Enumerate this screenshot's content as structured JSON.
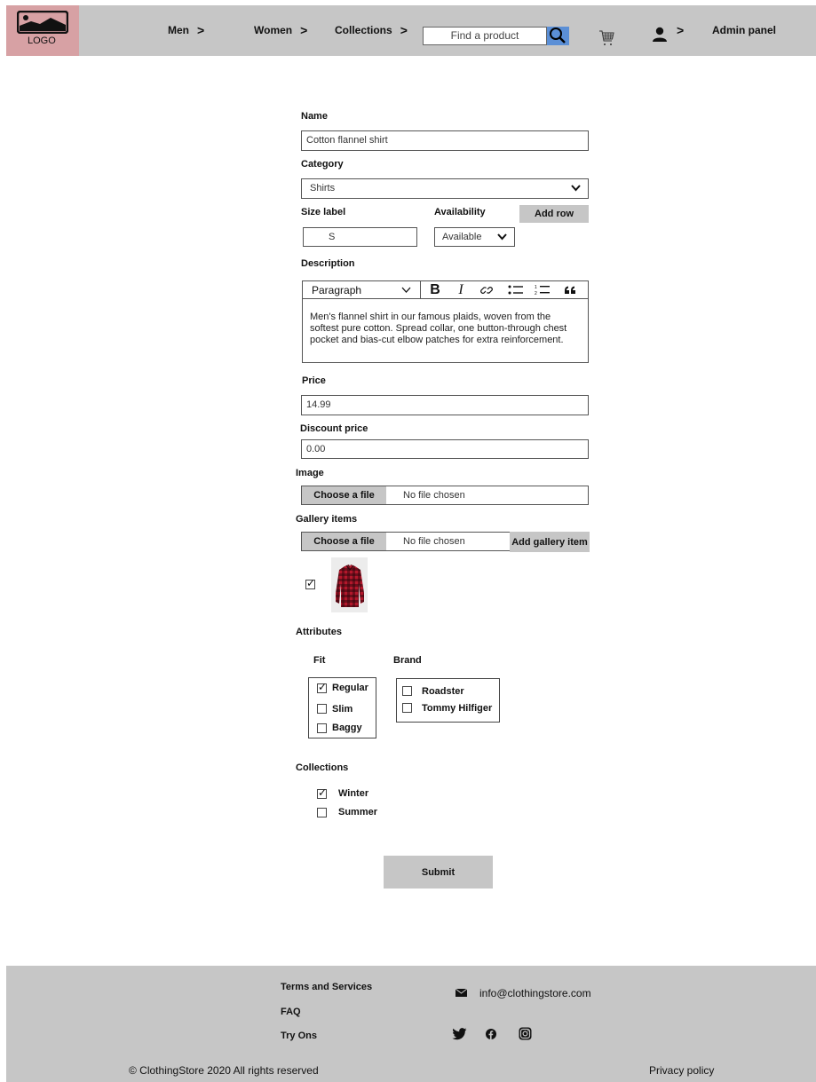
{
  "header": {
    "logo_text": "LOGO",
    "nav": [
      {
        "label": "Men"
      },
      {
        "label": "Women"
      },
      {
        "label": "Collections"
      }
    ],
    "chev": ">",
    "search_placeholder": "Find a product",
    "admin_label": "Admin panel",
    "accent_color": "#5b8fd6"
  },
  "form": {
    "name_label": "Name",
    "name_value": "Cotton flannel shirt",
    "category_label": "Category",
    "category_value": "Shirts",
    "size_label": "Size label",
    "size_value": "S",
    "availability_label": "Availability",
    "availability_value": "Available",
    "add_row_label": "Add row",
    "description_label": "Description",
    "editor_block_type": "Paragraph",
    "description_text": "Men's flannel shirt in our famous plaids, woven from the softest pure cotton. Spread collar, one button-through chest pocket and bias-cut elbow patches for extra reinforcement.",
    "price_label": "Price",
    "price_value": "14.99",
    "discount_label": "Discount price",
    "discount_value": "0.00",
    "image_label": "Image",
    "choose_file_label": "Choose a file",
    "no_file_label": "No file chosen",
    "gallery_label": "Gallery items",
    "add_gallery_label": "Add gallery item",
    "gallery_item_checked": true,
    "attributes_label": "Attributes",
    "fit_label": "Fit",
    "fit_options": [
      {
        "label": "Regular",
        "checked": true
      },
      {
        "label": "Slim",
        "checked": false
      },
      {
        "label": "Baggy",
        "checked": false
      }
    ],
    "brand_label": "Brand",
    "brand_options": [
      {
        "label": "Roadster",
        "checked": false
      },
      {
        "label": "Tommy Hilfiger",
        "checked": false
      }
    ],
    "collections_label": "Collections",
    "collection_options": [
      {
        "label": "Winter",
        "checked": true
      },
      {
        "label": "Summer",
        "checked": false
      }
    ],
    "submit_label": "Submit"
  },
  "footer": {
    "links": [
      "Terms and Services",
      "FAQ",
      "Try Ons"
    ],
    "email": "info@clothingstore.com",
    "copyright": "© ClothingStore 2020 All rights reserved",
    "privacy": "Privacy policy"
  }
}
